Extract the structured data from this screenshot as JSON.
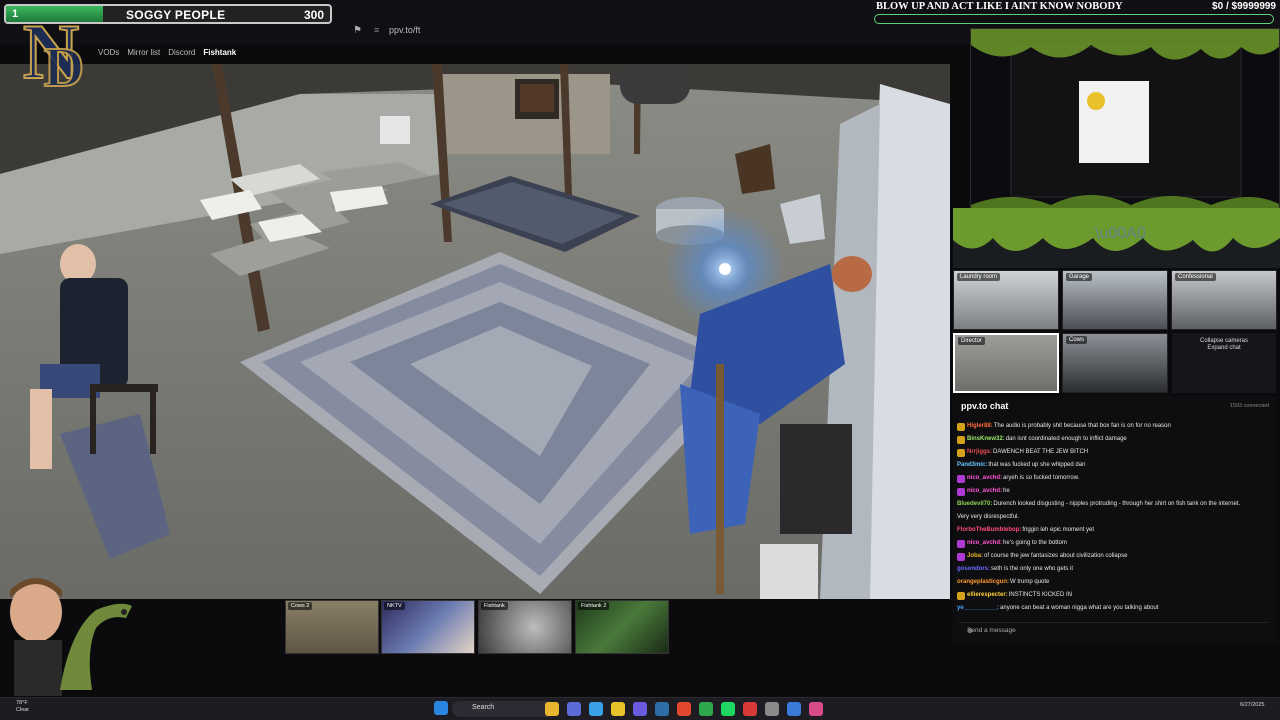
{
  "hud": {
    "level": "1",
    "label": "SOGGY PEOPLE",
    "value": "300",
    "fill_fraction": 0.3
  },
  "banner": {
    "title": "BLOW UP AND ACT LIKE I AINT KNOW NOBODY",
    "money": "$0  / $9999999"
  },
  "browser": {
    "url": "ppv.to/ft",
    "nav": [
      "VODs",
      "Mirror list",
      "Discord",
      "Fishtank"
    ]
  },
  "main_camera": {
    "name": "Director"
  },
  "thumbnails": [
    {
      "label": "Cows 2"
    },
    {
      "label": "NKTV"
    },
    {
      "label": "Fishtank"
    },
    {
      "label": "Fishtank 2"
    }
  ],
  "cam_grid": [
    {
      "label": "Laundry room"
    },
    {
      "label": "Garage"
    },
    {
      "label": "Confessional"
    },
    {
      "label": "Director"
    },
    {
      "label": "Cows"
    }
  ],
  "collapse": {
    "line1": "Collapse cameras",
    "line2": "Expand chat"
  },
  "chat": {
    "title": "ppv.to chat",
    "connected": "1593 connected",
    "placeholder": "Send a message",
    "messages": [
      {
        "user": "Higler88:",
        "text": " The audio is probably shit because that box fan is on for no reason",
        "color": "#ff6a3d",
        "badge": "#d4a21a"
      },
      {
        "user": "BinsKnew32:",
        "text": " dan isnt coordinated enough to inflict damage",
        "color": "#9ee86a",
        "badge": "#d4a21a"
      },
      {
        "user": "Nrrjiggs:",
        "text": " DAWENCH BEAT THE JEW BITCH",
        "color": "#e84d4d",
        "badge": "#d4a21a"
      },
      {
        "user": "Pand3mic:",
        "text": " that was fucked up she whipped dan",
        "color": "#67c6ff",
        "badge": ""
      },
      {
        "user": "nico_avchd:",
        "text": " aryeh is so fucked tomorrow.",
        "color": "#ff58d2",
        "badge": "#b03ad4"
      },
      {
        "user": "nico_avchd:",
        "text": " he",
        "color": "#ff58d2",
        "badge": "#b03ad4"
      },
      {
        "user": "Bluedevil70:",
        "text": " Durench looked disgusting - nipples protruding - through her shirt on fish tank on the internet.",
        "color": "#8fd35a",
        "badge": ""
      },
      {
        "user": "",
        "text": "Very very disrespectful.",
        "color": "#e6e6e6",
        "badge": ""
      },
      {
        "user": "FlorboTheBumblebop:",
        "text": " friggin leh epic moment yet",
        "color": "#ff4d7a",
        "badge": ""
      },
      {
        "user": "nico_avchd:",
        "text": " he's going to the bottom",
        "color": "#ff58d2",
        "badge": "#b03ad4"
      },
      {
        "user": "Joba:",
        "text": " of course the jew fantasizes about civilization collapse",
        "color": "#e8b52e",
        "badge": "#b03ad4"
      },
      {
        "user": "gosondors:",
        "text": " seth is the only one who gets it",
        "color": "#6a6aff",
        "badge": ""
      },
      {
        "user": "orangeplasticgun:",
        "text": " W trump quote",
        "color": "#ff9a2e",
        "badge": ""
      },
      {
        "user": "ellierespecter:",
        "text": " INSTINCTS KICKED IN",
        "color": "#ffd23a",
        "badge": "#d4a21a"
      },
      {
        "user": "ye__________:",
        "text": " anyone can beat a woman nigga what are you talking about",
        "color": "#4da3ff",
        "badge": ""
      }
    ]
  },
  "taskbar": {
    "weather_temp": "78°F",
    "weather_desc": "Clear",
    "search": "Search",
    "time": "",
    "date": "6/27/2025"
  },
  "colors": {
    "hp_green": "#3cb85c",
    "accent_green": "#5fd07a",
    "chat_bg": "#0e0e11"
  },
  "icons": [
    "bookmark-icon",
    "settings-icon",
    "search-icon",
    "windows-icon",
    "gear-icon"
  ]
}
